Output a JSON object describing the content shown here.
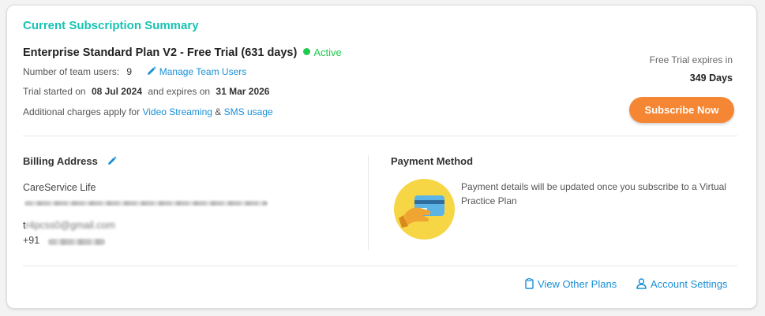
{
  "summary": {
    "title": "Current Subscription Summary",
    "plan_name": "Enterprise Standard Plan V2 - Free Trial (631 days)",
    "status": "Active",
    "team_users_label": "Number of team users:",
    "team_users_count": "9",
    "manage_team_users": "Manage Team Users",
    "trial_started_label": "Trial started on",
    "trial_start_date": "08 Jul 2024",
    "expires_on_label": "and expires on",
    "expire_date": "31 Mar 2026",
    "charges_label": "Additional charges apply for",
    "video_streaming": "Video Streaming",
    "ampersand": "&",
    "sms_usage": "SMS usage",
    "expires_in_label": "Free Trial expires in",
    "expires_in_days": "349 Days",
    "subscribe_button": "Subscribe Now"
  },
  "billing": {
    "title": "Billing Address",
    "name": "CareService Life",
    "email_visible": "t",
    "email_obscured": "r4pcss0@gmail.com",
    "phone_prefix": "+91"
  },
  "payment": {
    "title": "Payment Method",
    "message": "Payment details will be updated once you subscribe to a Virtual Practice Plan"
  },
  "footer": {
    "view_other_plans": "View Other Plans",
    "account_settings": "Account Settings"
  },
  "colors": {
    "accent_teal": "#17c3b2",
    "link_blue": "#1a8fd6",
    "active_green": "#1ecb4f",
    "subscribe_orange": "#f58634"
  },
  "icons": {
    "status": "dot-icon",
    "manage_users": "pencil-icon",
    "billing_edit": "pencil-icon",
    "payment": "card-hand-illustration",
    "view_plans": "clipboard-icon",
    "account_settings": "user-icon"
  }
}
